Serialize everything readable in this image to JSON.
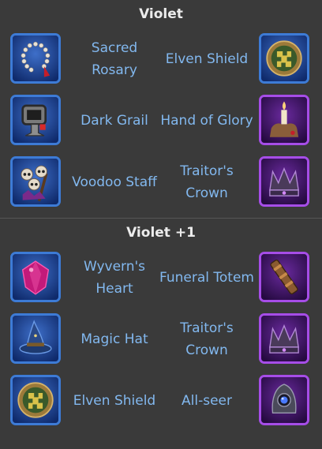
{
  "sections": [
    {
      "title": "Violet",
      "rows": [
        {
          "left": {
            "name": "Sacred Rosary",
            "icon": "rosary-icon"
          },
          "right": {
            "name": "Elven Shield",
            "icon": "elven-shield-icon"
          }
        },
        {
          "left": {
            "name": "Dark Grail",
            "icon": "grail-icon"
          },
          "right": {
            "name": "Hand of Glory",
            "icon": "hand-candle-icon"
          }
        },
        {
          "left": {
            "name": "Voodoo Staff",
            "icon": "skull-staff-icon"
          },
          "right": {
            "name": "Traitor's Crown",
            "icon": "crown-icon"
          }
        }
      ]
    },
    {
      "title": "Violet +1",
      "rows": [
        {
          "left": {
            "name": "Wyvern's Heart",
            "icon": "gem-heart-icon"
          },
          "right": {
            "name": "Funeral Totem",
            "icon": "totem-icon"
          }
        },
        {
          "left": {
            "name": "Magic Hat",
            "icon": "wizard-hat-icon"
          },
          "right": {
            "name": "Traitor's Crown",
            "icon": "crown-icon"
          }
        },
        {
          "left": {
            "name": "Elven Shield",
            "icon": "elven-shield-icon"
          },
          "right": {
            "name": "All-seer",
            "icon": "eye-helm-icon"
          }
        }
      ]
    }
  ],
  "colors": {
    "background": "#3a3a3a",
    "title": "#ececec",
    "label": "#82b8ef",
    "blue_frame": "#3d7bd6",
    "purple_frame": "#a64de8"
  }
}
